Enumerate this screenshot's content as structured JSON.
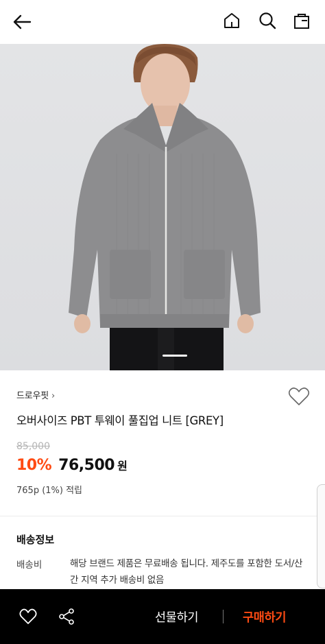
{
  "header": {
    "back_icon": "arrow-left-icon",
    "home_icon": "home-icon",
    "search_icon": "search-icon",
    "bag_icon": "shopping-bag-icon"
  },
  "product": {
    "brand": "드로우핏",
    "brand_chevron": "›",
    "title": "오버사이즈 PBT 투웨이 풀집업 니트 [GREY]",
    "original_price": "85,000",
    "discount": "10%",
    "price": "76,500",
    "currency": "원",
    "points": "765p (1%) 적립",
    "image_carousel": {
      "current": 2,
      "total": 3
    }
  },
  "shipping": {
    "heading": "배송정보",
    "fee_label": "배송비",
    "fee_value": "해당 브랜드 제품은 무료배송 됩니다. 제주도를 포함한 도서/산간 지역 추가 배송비 없음"
  },
  "bottom_bar": {
    "gift_label": "선물하기",
    "buy_label": "구매하기"
  },
  "colors": {
    "accent": "#ff4b13",
    "bottom_bar_bg": "#000000",
    "knit_grey": "#8d8d8f"
  }
}
